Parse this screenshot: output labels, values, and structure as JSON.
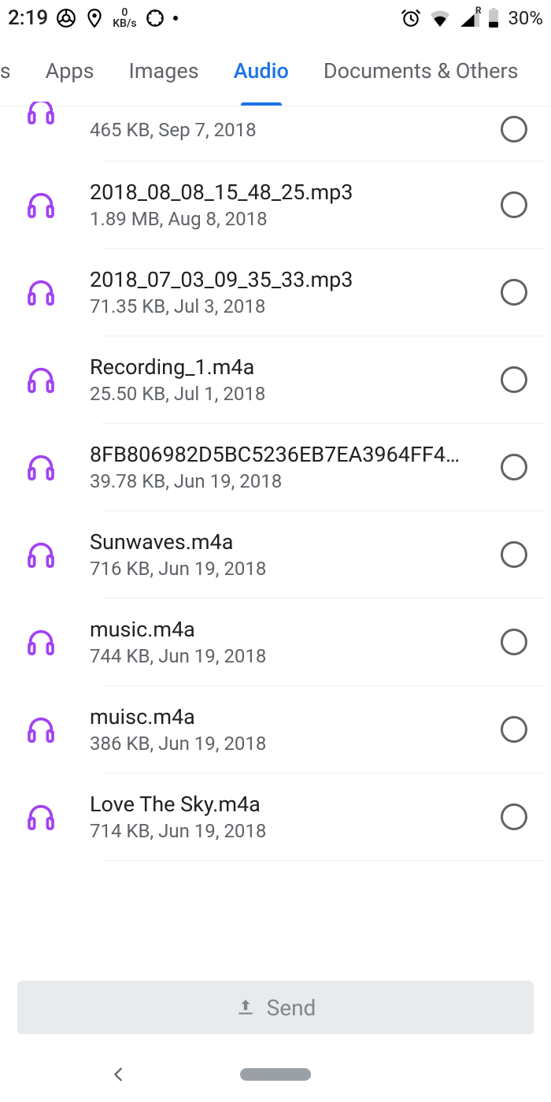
{
  "status": {
    "time": "2:19",
    "kbs_top": "0",
    "kbs_bottom": "KB/s",
    "roaming": "R",
    "battery": "30%"
  },
  "tabs": {
    "partial_left": "eos",
    "items": [
      "Apps",
      "Images",
      "Audio",
      "Documents & Others"
    ],
    "active_index": 2
  },
  "files": [
    {
      "name": "",
      "meta": "465 KB, Sep 7, 2018",
      "partial": true
    },
    {
      "name": "2018_08_08_15_48_25.mp3",
      "meta": "1.89 MB, Aug 8, 2018"
    },
    {
      "name": "2018_07_03_09_35_33.mp3",
      "meta": "71.35 KB, Jul 3, 2018"
    },
    {
      "name": "Recording_1.m4a",
      "meta": "25.50 KB, Jul 1, 2018"
    },
    {
      "name": "8FB806982D5BC5236EB7EA3964FF4…",
      "meta": "39.78 KB, Jun 19, 2018"
    },
    {
      "name": "Sunwaves.m4a",
      "meta": "716 KB, Jun 19, 2018"
    },
    {
      "name": "music.m4a",
      "meta": "744 KB, Jun 19, 2018"
    },
    {
      "name": "muisc.m4a",
      "meta": "386 KB, Jun 19, 2018"
    },
    {
      "name": "Love The Sky.m4a",
      "meta": "714 KB, Jun 19, 2018"
    }
  ],
  "send": {
    "label": "Send"
  }
}
